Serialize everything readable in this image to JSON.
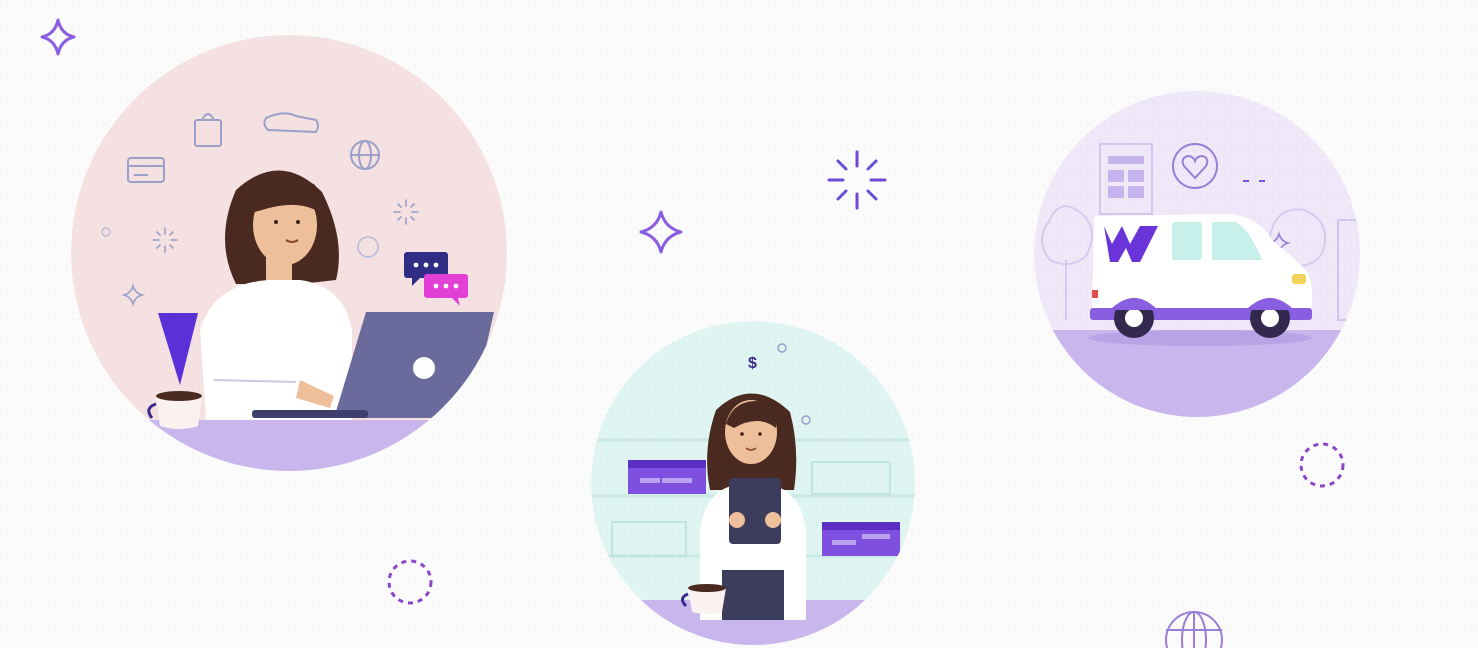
{
  "illustration": {
    "colors": {
      "accent": "#7f4fe0",
      "accent_dark": "#3a2a8f",
      "accent_light": "#c9b4f0",
      "pink_bg": "#f5e1e2",
      "mint_bg": "#dff5f2",
      "lilac_bg": "#efe8f8",
      "floor": "#c9b6ec",
      "hair": "#4a2a20",
      "skin": "#eebf9a",
      "laptop": "#6a6a9c",
      "magenta": "#e23fd4",
      "navy": "#2f2e84",
      "background": "#fbfbfc"
    },
    "scenes": [
      {
        "name": "woman-shopping-online-on-laptop",
        "icons": [
          "shopping-bag-icon",
          "sneaker-icon",
          "globe-icon",
          "credit-card-icon",
          "chat-bubbles-icon",
          "coffee-cup-icon"
        ]
      },
      {
        "name": "seller-checking-tablet-with-packages",
        "icons": [
          "dollar-icon",
          "sparkle-icon",
          "box-icon",
          "coffee-cup-icon"
        ]
      },
      {
        "name": "delivery-van",
        "icons": [
          "heart-icon",
          "brand-logo-icon",
          "building-icon",
          "tree-icon"
        ]
      }
    ],
    "decorations": [
      "sparkle-icon",
      "burst-icon",
      "dotted-circle-icon",
      "globe-icon"
    ]
  }
}
